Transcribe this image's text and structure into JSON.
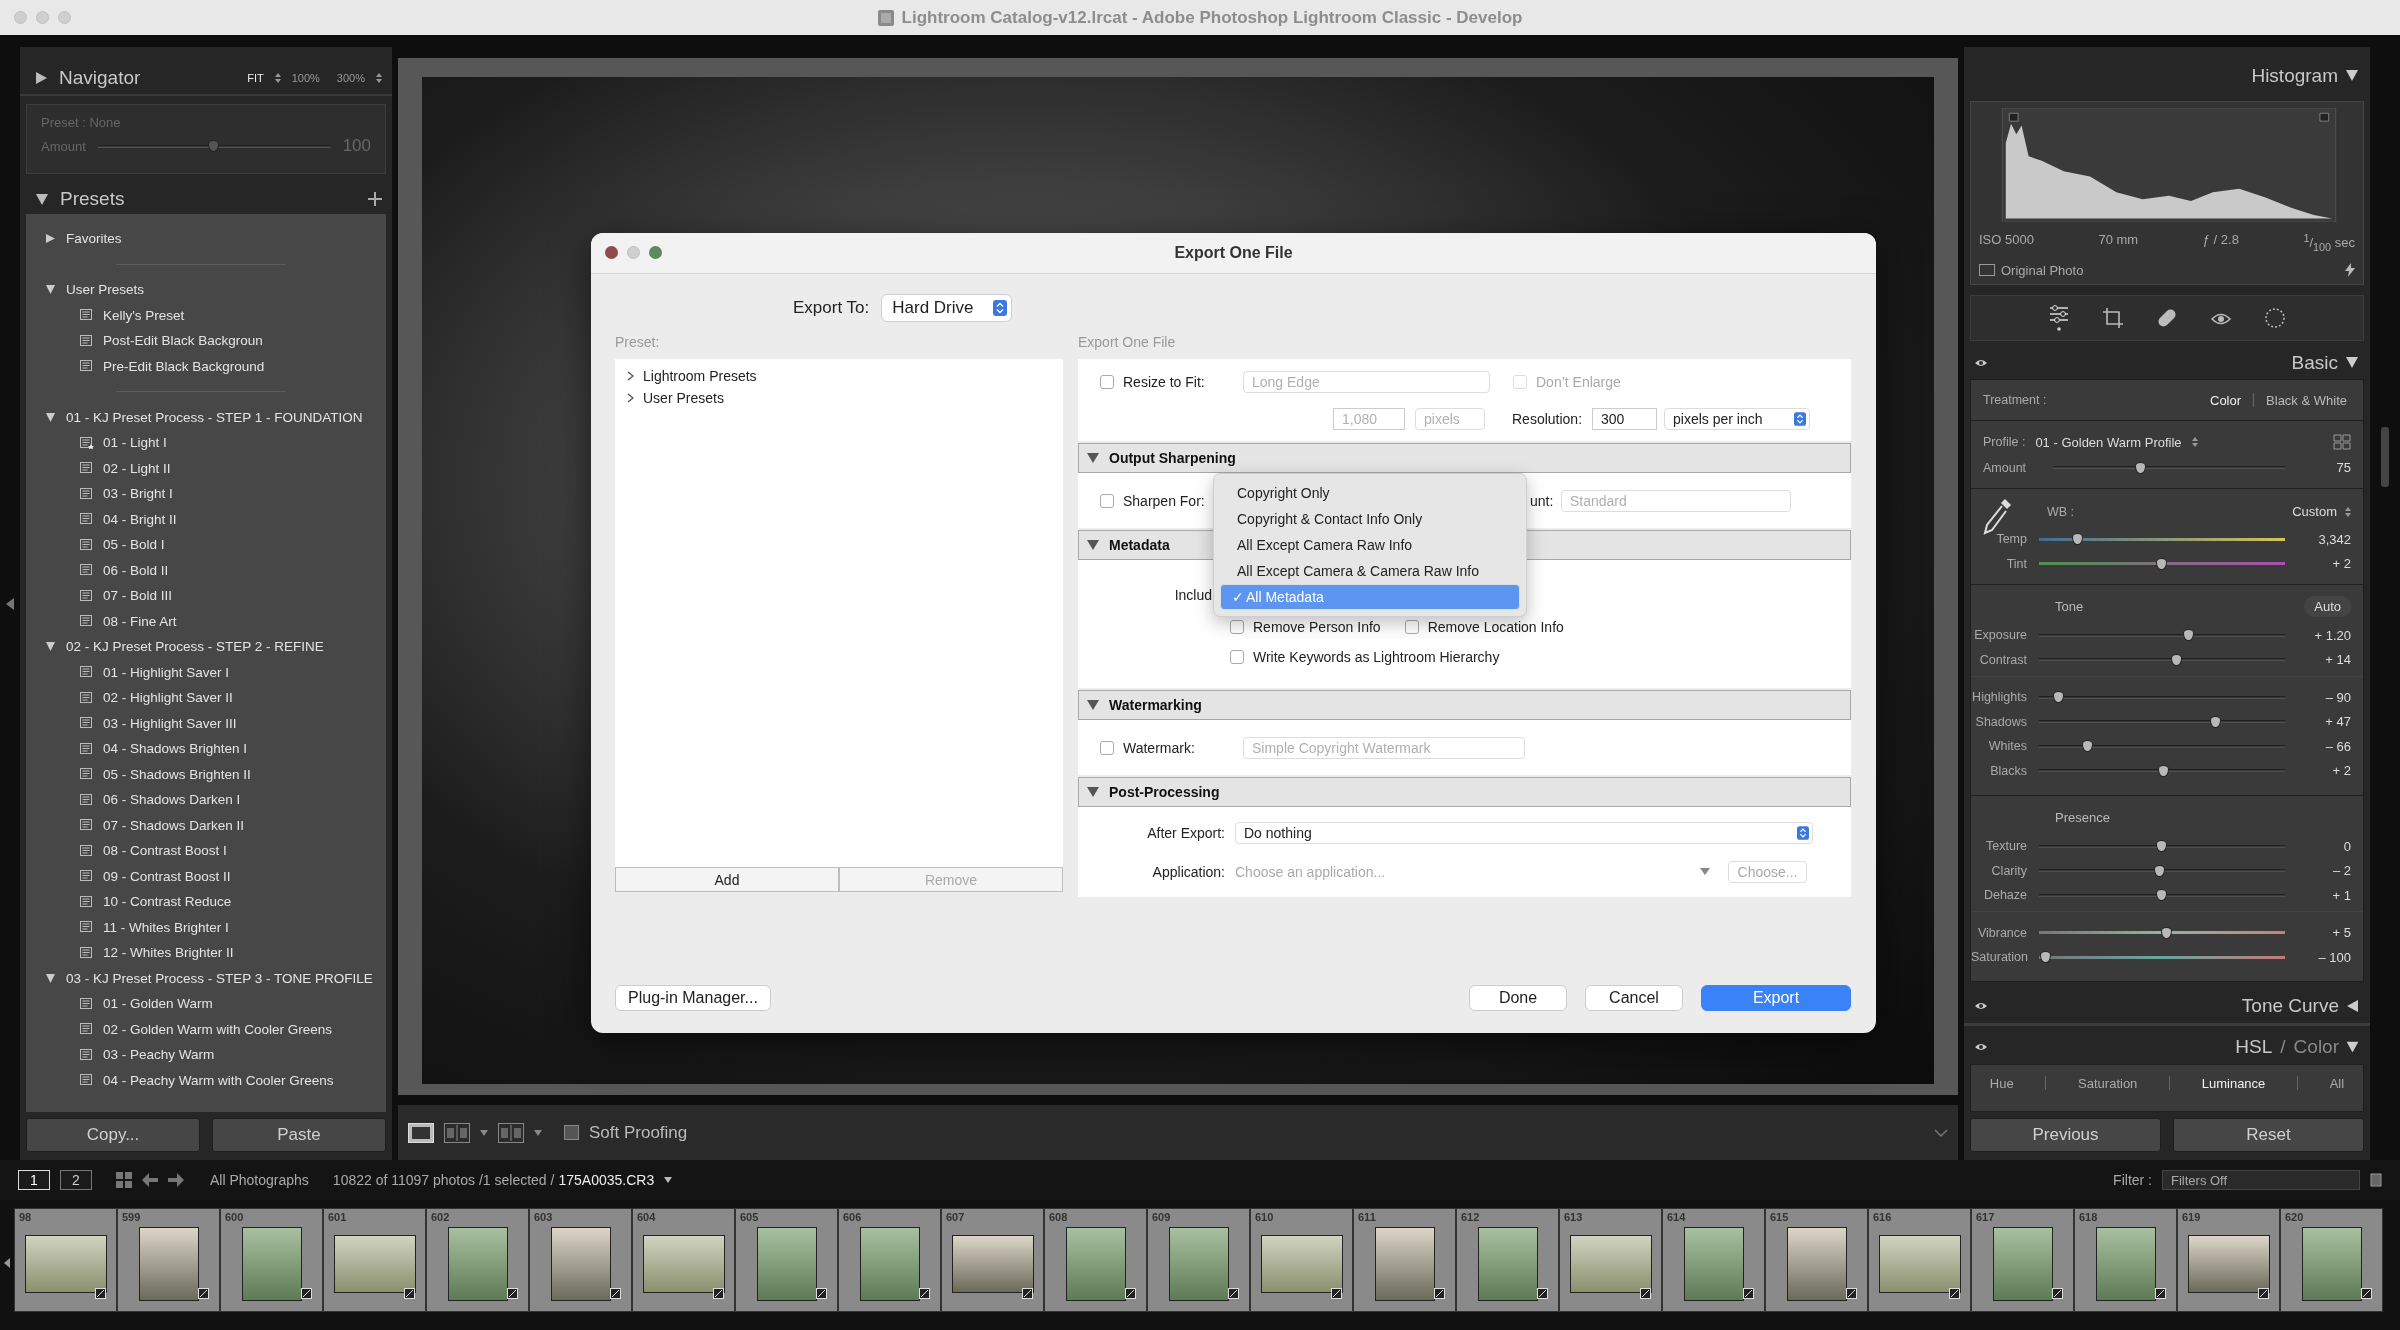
{
  "window": {
    "title": "Lightroom Catalog-v12.lrcat - Adobe Photoshop Lightroom Classic - Develop"
  },
  "navigator": {
    "title": "Navigator",
    "zoom_options": [
      {
        "label": "FIT",
        "selected": true
      },
      {
        "label": "100%",
        "selected": false
      },
      {
        "label": "300%",
        "selected": false
      }
    ]
  },
  "preset_amount": {
    "preset_label": "Preset : None",
    "amount_label": "Amount",
    "level": 0.5,
    "reading": "100"
  },
  "presets": {
    "title": "Presets",
    "groups": [
      {
        "name": "Favorites",
        "expanded": false,
        "divider_after": true
      },
      {
        "name": "User Presets",
        "expanded": true,
        "divider_after": true,
        "children": [
          {
            "name": "Kelly's Preset",
            "starred": false
          },
          {
            "name": "Post-Edit Black Backgroun",
            "starred": false
          },
          {
            "name": "Pre-Edit Black Background",
            "starred": false
          }
        ]
      },
      {
        "name": "01 - KJ Preset Process - STEP 1 - FOUNDATION",
        "expanded": true,
        "divider_after": false,
        "children": [
          {
            "name": "01 - Light I",
            "starred": true
          },
          {
            "name": "02 - Light II",
            "starred": false
          },
          {
            "name": "03 - Bright I",
            "starred": false
          },
          {
            "name": "04 - Bright II",
            "starred": false
          },
          {
            "name": "05 - Bold I",
            "starred": false
          },
          {
            "name": "06 - Bold II",
            "starred": false
          },
          {
            "name": "07 - Bold III",
            "starred": false
          },
          {
            "name": "08 - Fine Art",
            "starred": false
          }
        ]
      },
      {
        "name": "02 - KJ Preset Process - STEP 2 - REFINE",
        "expanded": true,
        "divider_after": false,
        "children": [
          {
            "name": "01 - Highlight Saver I",
            "starred": false
          },
          {
            "name": "02 - Highlight Saver II",
            "starred": false
          },
          {
            "name": "03 - Highlight Saver III",
            "starred": false
          },
          {
            "name": "04 - Shadows Brighten I",
            "starred": false
          },
          {
            "name": "05 - Shadows Brighten II",
            "starred": false
          },
          {
            "name": "06 - Shadows Darken I",
            "starred": false
          },
          {
            "name": "07 - Shadows Darken II",
            "starred": false
          },
          {
            "name": "08 - Contrast Boost I",
            "starred": false
          },
          {
            "name": "09 - Contrast Boost II",
            "starred": false
          },
          {
            "name": "10 - Contrast Reduce",
            "starred": false
          },
          {
            "name": "11 - Whites Brighter I",
            "starred": false
          },
          {
            "name": "12 - Whites Brighter II",
            "starred": false
          }
        ]
      },
      {
        "name": "03 - KJ Preset Process - STEP 3 - TONE PROFILE",
        "expanded": true,
        "divider_after": false,
        "children": [
          {
            "name": "01 - Golden Warm",
            "starred": false
          },
          {
            "name": "02 - Golden Warm with Cooler Greens",
            "starred": false
          },
          {
            "name": "03 - Peachy Warm",
            "starred": false
          },
          {
            "name": "04 - Peachy Warm with Cooler Greens",
            "starred": false
          }
        ]
      }
    ]
  },
  "copy_paste": [
    "Copy...",
    "Paste"
  ],
  "toolbar": {
    "soft_proofing": {
      "label": "Soft Proofing",
      "checked": false
    }
  },
  "export_dialog": {
    "title": "Export One File",
    "export_to_label": "Export To:",
    "export_to": "Hard Drive",
    "preset_label": "Preset:",
    "preset_folders": [
      {
        "name": "Lightroom Presets",
        "expanded": false
      },
      {
        "name": "User Presets",
        "expanded": false
      }
    ],
    "preset_buttons": [
      {
        "label": "Add",
        "disabled": false
      },
      {
        "label": "Remove",
        "disabled": true
      }
    ],
    "plugin_manager": "Plug-in Manager...",
    "settings_label": "Export One File",
    "sizing": {
      "resize": {
        "label": "Resize to Fit:",
        "checked": false
      },
      "resize_mode": "Long Edge",
      "dont_enlarge": {
        "label": "Don’t Enlarge",
        "checked": false
      },
      "size": "1,080",
      "size_unit": "pixels",
      "resolution_label": "Resolution:",
      "resolution": "300",
      "resolution_unit": "pixels per inch"
    },
    "output_sharpening": {
      "title": "Output Sharpening",
      "expanded": true,
      "sharpen": {
        "label": "Sharpen For:",
        "checked": false
      },
      "amount_label": "unt:",
      "amount": "Standard"
    },
    "metadata": {
      "title": "Metadata",
      "expanded": true,
      "include_label": "Includ",
      "options": [
        {
          "label": "Remove Person Info",
          "checked": false
        },
        {
          "label": "Remove Location Info",
          "checked": false
        },
        {
          "label": "Write Keywords as Lightroom Hierarchy",
          "checked": false
        }
      ]
    },
    "include_menu": {
      "check_mark": "✓",
      "items": [
        {
          "label": "Copyright Only",
          "selected": false
        },
        {
          "label": "Copyright & Contact Info Only",
          "selected": false
        },
        {
          "label": "All Except Camera Raw Info",
          "selected": false
        },
        {
          "label": "All Except Camera & Camera Raw Info",
          "selected": false
        },
        {
          "label": "All Metadata",
          "selected": true
        }
      ]
    },
    "watermarking": {
      "title": "Watermarking",
      "expanded": true,
      "watermark": {
        "label": "Watermark:",
        "checked": false
      },
      "style": "Simple Copyright Watermark"
    },
    "post_processing": {
      "title": "Post-Processing",
      "expanded": true,
      "after_export_label": "After Export:",
      "after_export": "Do nothing",
      "application_label": "Application:",
      "application_placeholder": "Choose an application...",
      "choose_button": "Choose..."
    },
    "buttons": [
      {
        "label": "Done",
        "kind": "normal"
      },
      {
        "label": "Cancel",
        "kind": "normal"
      },
      {
        "label": "Export",
        "kind": "primary"
      }
    ]
  },
  "histogram": {
    "title": "Histogram",
    "info": [
      "ISO 5000",
      "70 mm",
      "ƒ / 2.8",
      "$^{1}$/$_{100}$ sec"
    ],
    "original_photo": {
      "label": "Original Photo",
      "checked": false
    }
  },
  "basic": {
    "title": "Basic",
    "treatment_label": "Treatment :",
    "treatments": [
      {
        "label": "Color",
        "selected": true
      },
      {
        "label": "Black & White",
        "selected": false
      }
    ],
    "profile_label": "Profile :",
    "profile": "01 - Golden Warm Profile",
    "amount": {
      "label": "Amount",
      "kind": "plain",
      "level": 0.38,
      "reading": "75"
    },
    "wb_label": "WB :",
    "wb": "Custom",
    "wb_sliders": [
      {
        "label": "Temp",
        "kind": "temp",
        "level": 0.16,
        "reading": "3,342"
      },
      {
        "label": "Tint",
        "kind": "tint",
        "level": 0.5,
        "reading": "+ 2"
      }
    ],
    "tone_label": "Tone",
    "auto": "Auto",
    "tone_sliders": [
      [
        {
          "label": "Exposure",
          "kind": "plain",
          "level": 0.61,
          "reading": "+ 1.20"
        },
        {
          "label": "Contrast",
          "kind": "plain",
          "level": 0.56,
          "reading": "+ 14"
        }
      ],
      [
        {
          "label": "Highlights",
          "kind": "plain",
          "level": 0.08,
          "reading": "– 90"
        },
        {
          "label": "Shadows",
          "kind": "plain",
          "level": 0.72,
          "reading": "+ 47"
        },
        {
          "label": "Whites",
          "kind": "plain",
          "level": 0.2,
          "reading": "– 66"
        },
        {
          "label": "Blacks",
          "kind": "plain",
          "level": 0.51,
          "reading": "+ 2"
        }
      ]
    ],
    "presence_label": "Presence",
    "presence_sliders": [
      [
        {
          "label": "Texture",
          "kind": "plain",
          "level": 0.5,
          "reading": "0"
        },
        {
          "label": "Clarity",
          "kind": "plain",
          "level": 0.49,
          "reading": "– 2"
        },
        {
          "label": "Dehaze",
          "kind": "plain",
          "level": 0.5,
          "reading": "+ 1"
        }
      ],
      [
        {
          "label": "Vibrance",
          "kind": "vibrance",
          "level": 0.52,
          "reading": "+ 5"
        },
        {
          "label": "Saturation",
          "kind": "saturation",
          "level": 0.03,
          "reading": "– 100"
        }
      ]
    ]
  },
  "tone_curve": {
    "title": "Tone Curve",
    "expanded": false
  },
  "hsl": {
    "title": "HSL",
    "separator": "/",
    "alt_title": "Color",
    "expanded": true,
    "tabs": [
      {
        "label": "Hue",
        "selected": false
      },
      {
        "label": "Saturation",
        "selected": false
      },
      {
        "label": "Luminance",
        "selected": true
      },
      {
        "label": "All",
        "selected": false
      }
    ]
  },
  "panel_buttons": [
    "Previous",
    "Reset"
  ],
  "filmstrip": {
    "pages": [
      {
        "label": "1",
        "selected": true
      },
      {
        "label": "2",
        "selected": false
      }
    ],
    "source": "All Photographs",
    "count": "10822 of 11097 photos /1 selected /",
    "file": "175A0035.CR3",
    "filter_label": "Filter :",
    "filter": "Filters Off",
    "thumbs": [
      "98",
      "599",
      "600",
      "601",
      "602",
      "603",
      "604",
      "605",
      "606",
      "607",
      "608",
      "609",
      "610",
      "611",
      "612",
      "613",
      "614",
      "615",
      "616",
      "617",
      "618",
      "619",
      "620"
    ]
  }
}
